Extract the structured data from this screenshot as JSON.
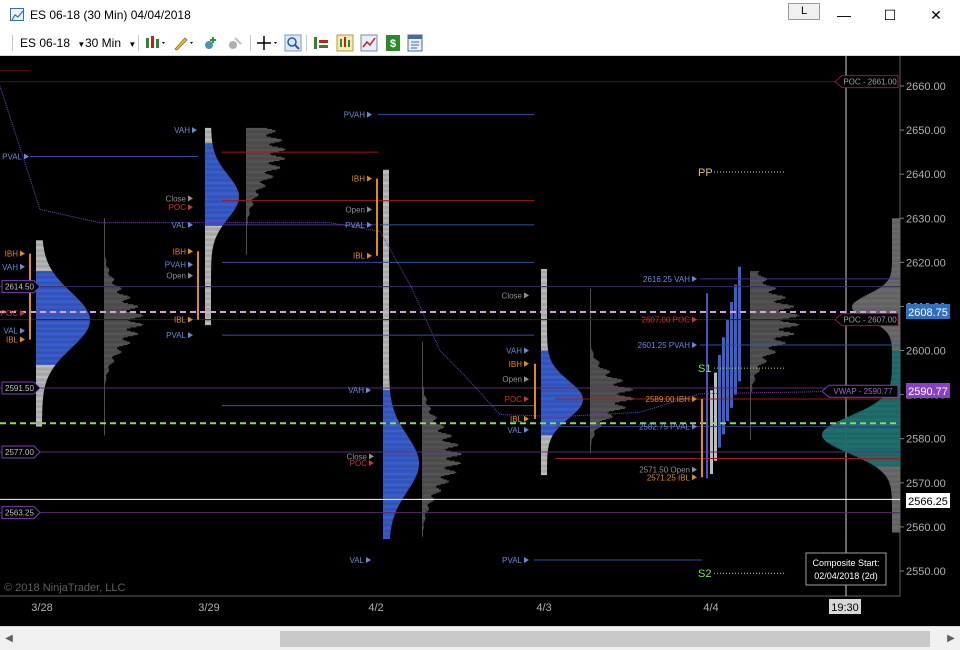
{
  "window": {
    "title": "ES 06-18 (30 Min)  04/04/2018",
    "l_button": "L",
    "minimize": "—",
    "maximize": "☐",
    "close": "✕"
  },
  "toolbar": {
    "instrument": "ES 06-18",
    "interval": "30 Min"
  },
  "price_axis": {
    "ticks": [
      "2660.00",
      "2650.00",
      "2640.00",
      "2630.00",
      "2620.00",
      "2610.00",
      "2600.00",
      "2590.00",
      "2580.00",
      "2570.00",
      "2560.00",
      "2550.00"
    ],
    "current_price": "2608.75",
    "vwap_price": "2590.77",
    "low_price": "2566.25",
    "colors": {
      "current": "#2f6fc0",
      "vwap": "#8a3fc8",
      "low": "#ffffff"
    }
  },
  "time_axis": {
    "labels": [
      "3/28",
      "3/29",
      "4/2",
      "4/3",
      "4/4"
    ],
    "cursor_time": "19:30"
  },
  "copyright": "© 2018 NinjaTrader, LLC",
  "composite": {
    "line1": "Composite Start:",
    "line2": "02/04/2018 (2d)"
  },
  "left_levels": [
    "2614.50",
    "2591.50",
    "2577.00",
    "2563.25"
  ],
  "pivots": {
    "pp": "PP",
    "s1": "S1",
    "s2": "S2"
  },
  "poc_right": {
    "upper": "POC - 2661.00",
    "lower": "POC - 2607.00"
  },
  "vwap_label": "VWAP - 2590.77",
  "session_labels": {
    "s328": {
      "pval": "PVAL",
      "ibh": "IBH",
      "vah": "VAH",
      "poc": "POC",
      "val": "VAL",
      "ibl": "IBL"
    },
    "s329": {
      "vah": "VAH",
      "close": "Close",
      "poc": "POC",
      "val": "VAL",
      "ibh": "IBH",
      "pvah": "PVAH",
      "open": "Open",
      "ibl": "IBL",
      "pval": "PVAL"
    },
    "s42": {
      "pvah": "PVAH",
      "ibh": "IBH",
      "open": "Open",
      "close": "Close",
      "pval": "PVAL",
      "ibl": "IBL",
      "vah": "VAH",
      "close2": "Close",
      "poc": "POC",
      "val": "VAL"
    },
    "s43": {
      "close": "Close",
      "vah": "VAH",
      "ibh": "IBH",
      "open": "Open",
      "poc": "POC",
      "ibl": "IBL",
      "val": "VAL",
      "pval": "PVAL"
    },
    "s44": {
      "vah_label": "2616.25 VAH",
      "poc_label": "2607.00 POC",
      "pvah_label": "2601.25 PVAH",
      "ibh_label": "2589.00 IBH",
      "pval_label": "2582.75 PVAL",
      "open_label": "2571.50 Open",
      "ibl_label": "2571.25 IBL"
    }
  }
}
